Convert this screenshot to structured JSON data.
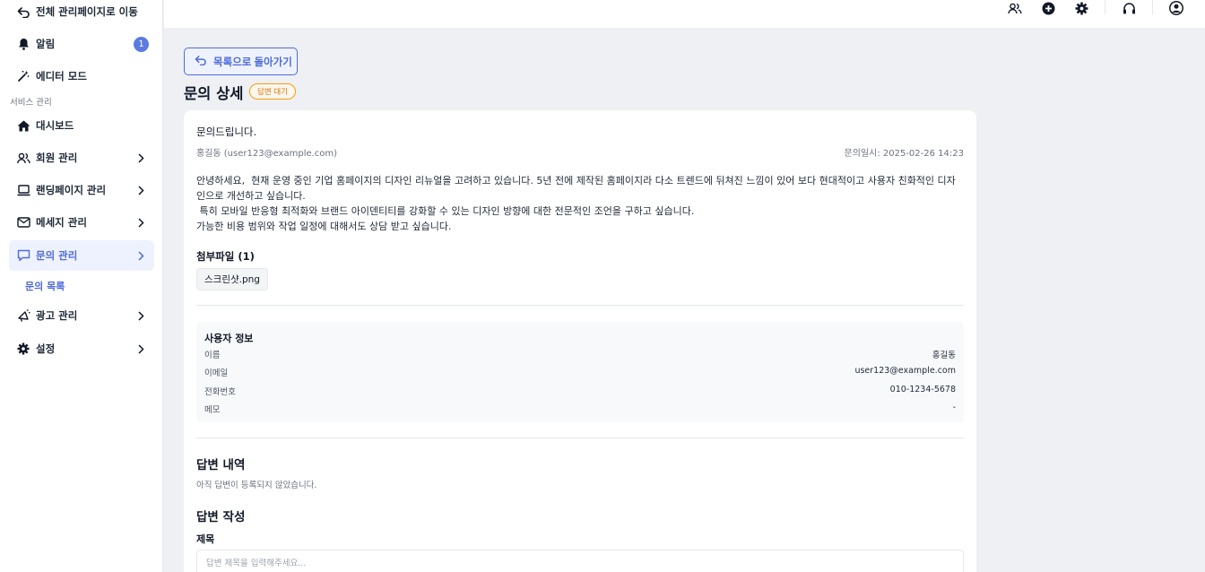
{
  "sidebar": {
    "back_link": "전체 관리페이지로 이동",
    "notifications": {
      "label": "알림",
      "count": "1"
    },
    "editor_mode": "에디터 모드",
    "section_label": "서비스 관리",
    "items": [
      {
        "label": "대시보드",
        "icon": "home-icon"
      },
      {
        "label": "회원 관리",
        "icon": "users-icon"
      },
      {
        "label": "랜딩페이지 관리",
        "icon": "laptop-icon"
      },
      {
        "label": "메세지 관리",
        "icon": "mail-icon"
      },
      {
        "label": "문의 관리",
        "icon": "chat-icon",
        "active": true
      },
      {
        "label": "광고 관리",
        "icon": "megaphone-icon"
      },
      {
        "label": "설정",
        "icon": "gear-icon"
      }
    ],
    "sub_item": "문의 목록"
  },
  "topbar": {
    "icons": [
      "users-icon",
      "plus-circle-icon",
      "gear-icon",
      "headset-icon",
      "user-circle-icon"
    ]
  },
  "main": {
    "back_button": "목록으로 돌아가기",
    "title": "문의 상세",
    "status": "답변 대기",
    "inquiry": {
      "title": "문의드립니다.",
      "author": "홍길동 (user123@example.com)",
      "date": "문의일시: 2025-02-26 14:23",
      "body_lines": [
        "안녕하세요,  현재 운영 중인 기업 홈페이지의 디자인 리뉴얼을 고려하고 있습니다. 5년 전에 제작된 홈페이지라 다소 트렌드에 뒤쳐진 느낌이 있어 보다 현대적이고 사용자 친화적인 디자인으로 개선하고 싶습니다.",
        " 특히 모바일 반응형 최적화와 브랜드 아이덴티티를 강화할 수 있는 디자인 방향에 대한 전문적인 조언을 구하고 싶습니다.",
        "가능한 비용 범위와 작업 일정에 대해서도 상담 받고 싶습니다."
      ],
      "attachments_title": "첨부파일 (1)",
      "attachments": [
        "스크린샷.png"
      ]
    },
    "user_info": {
      "title": "사용자 정보",
      "rows": [
        {
          "label": "이름",
          "value": "홍길동"
        },
        {
          "label": "이메일",
          "value": "user123@example.com"
        },
        {
          "label": "전화번호",
          "value": "010-1234-5678"
        },
        {
          "label": "메모",
          "value": "-"
        }
      ]
    },
    "answers": {
      "title": "답변 내역",
      "empty": "아직 답변이 등록되지 않았습니다."
    },
    "write": {
      "title": "답변 작성",
      "subject_label": "제목",
      "subject_placeholder": "답변 제목을 입력해주세요..."
    }
  },
  "colors": {
    "accent": "#4f6bd8",
    "status": "#d97706",
    "background": "#eef0f4"
  }
}
